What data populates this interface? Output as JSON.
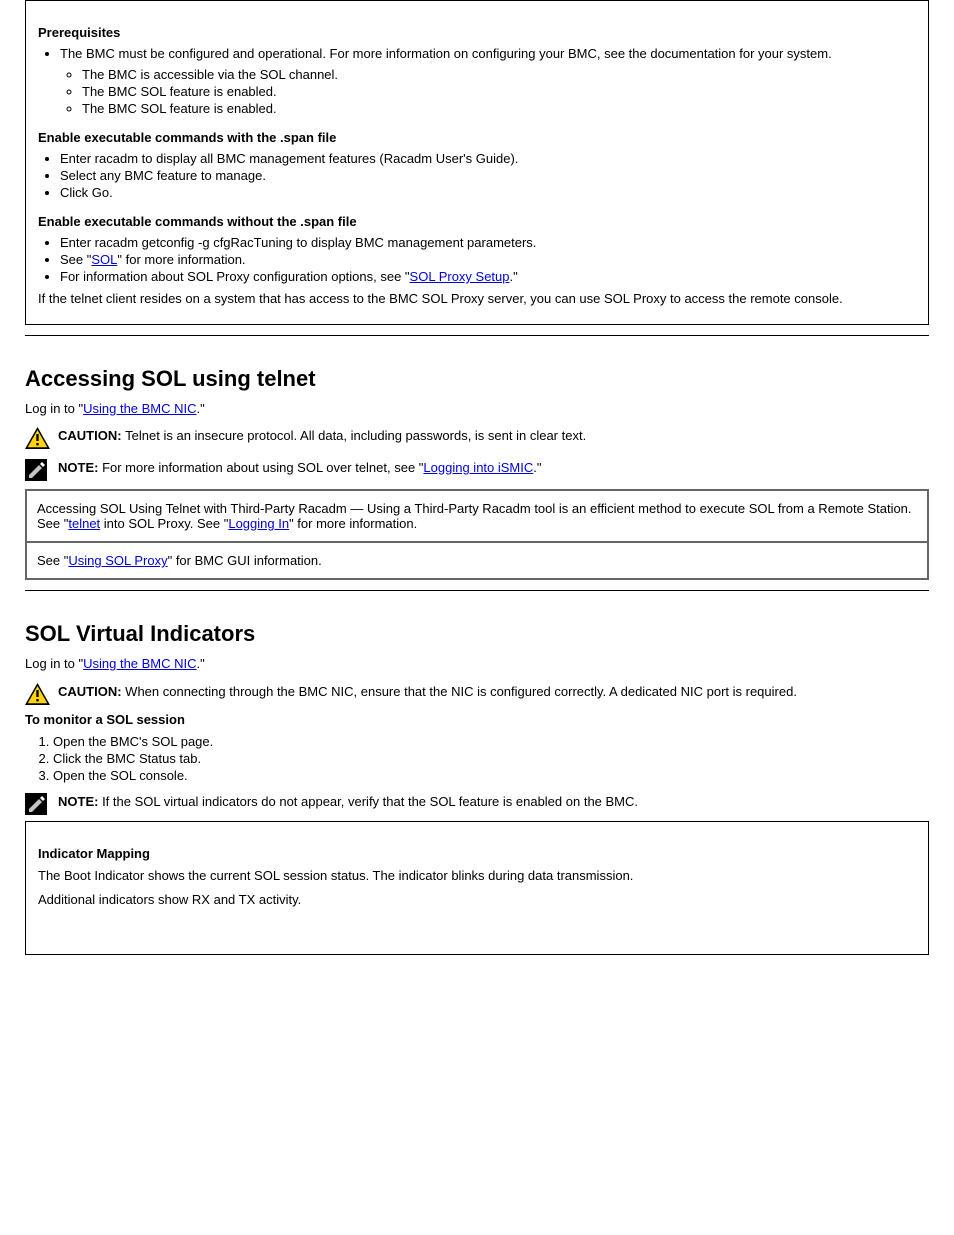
{
  "box_top": {
    "group1_title": "Prerequisites",
    "group1_items": [
      "The BMC must be configured and operational. For more information on configuring your BMC, see the documentation for your system.",
      "The BMC is accessible via the SOL channel.",
      "The BMC SOL feature is enabled."
    ],
    "group2_title": "Enable executable commands with the .span file",
    "group2_items": [
      "Enter racadm to display all BMC management features (Racadm User's Guide).",
      "Select any BMC feature to manage.",
      "Click Go."
    ],
    "group3_title": "Enable executable commands without the .span file",
    "group3_items": [
      "Enter racadm getconfig -g cfgRacTuning to display BMC management parameters."
    ],
    "item_sol_link": {
      "pre": "See \"",
      "link": "SOL",
      "post": "\" for more information."
    },
    "item_sol_proxy_link": {
      "pre": "For information about SOL Proxy configuration options, see \"",
      "link": "SOL Proxy Setup",
      "post": ".\""
    },
    "item_proxy_access": "If the telnet client resides on a system that has access to the BMC SOL Proxy server, you can use SOL Proxy to access the remote console."
  },
  "section_telnet": {
    "heading": "Accessing SOL using telnet",
    "intro_pre": "Log in to \"",
    "intro_link": "Using the BMC NIC",
    "intro_post": ".\"",
    "caution": {
      "label": "CAUTION: ",
      "text": "Telnet is an insecure protocol. All data, including passwords, is sent in clear text."
    },
    "note": {
      "label": "NOTE: ",
      "text_pre": "For more information about using SOL over telnet, see \"",
      "link": "Logging into iSMIC",
      "text_post": ".\""
    },
    "row1": {
      "pre": "Accessing SOL Using Telnet with Third‑Party Racadm — Using a Third‑Party Racadm tool is an efficient method to execute SOL from a Remote Station. See \"",
      "link1": "telnet",
      "mid": " into SOL Proxy. See \"",
      "link2": "Logging In",
      "post": "\" for more information."
    },
    "row2": {
      "pre": "See \"",
      "link": "Using SOL Proxy",
      "post": "\" for BMC GUI information."
    }
  },
  "section_virtual": {
    "heading": "SOL Virtual Indicators",
    "intro_pre": "Log in to \"",
    "intro_link": "Using the BMC NIC",
    "intro_post": ".\"",
    "caution": {
      "label": "CAUTION: ",
      "text": "When connecting through the BMC NIC, ensure that the NIC is configured correctly. A dedicated NIC port is required."
    },
    "steps_title": "To monitor a SOL session",
    "steps": [
      "Open the BMC's SOL page.",
      "Click the BMC Status tab.",
      "Open the SOL console."
    ],
    "note": {
      "label": "NOTE: ",
      "text": "If the SOL virtual indicators do not appear, verify that the SOL feature is enabled on the BMC."
    }
  },
  "box_bottom": {
    "title": "Indicator Mapping",
    "p1": "The Boot Indicator shows the current SOL session status. The indicator blinks during data transmission.",
    "p2": "Additional indicators show RX and TX activity."
  }
}
